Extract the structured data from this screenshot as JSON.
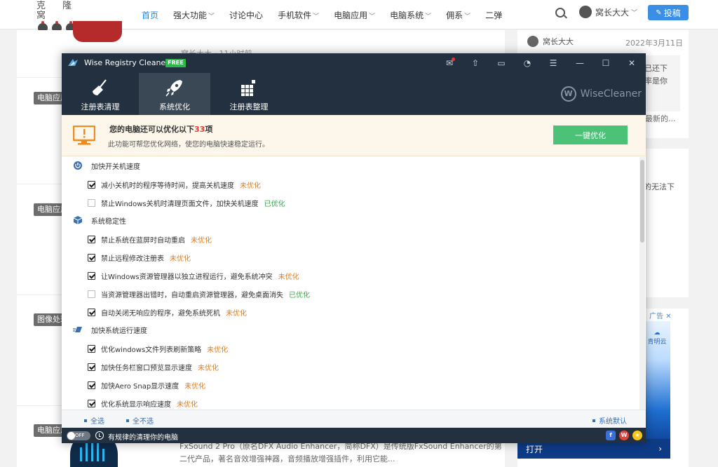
{
  "site": {
    "logo_text": "克 隆 窝",
    "nav": [
      {
        "label": "首页",
        "active": true,
        "has_menu": false
      },
      {
        "label": "强大功能",
        "has_menu": true
      },
      {
        "label": "讨论中心",
        "has_menu": false
      },
      {
        "label": "手机软件",
        "has_menu": true
      },
      {
        "label": "电脑应用",
        "has_menu": true
      },
      {
        "label": "电脑系统",
        "has_menu": true
      },
      {
        "label": "佣系",
        "has_menu": true
      },
      {
        "label": "二弹",
        "has_menu": false
      }
    ],
    "user_name": "窝长大大",
    "post_button": "投稿",
    "categories": [
      "电脑应用",
      "电脑应用",
      "图像处理",
      "电脑应用"
    ],
    "meta_text": "窝长大大 · 11小时前",
    "article_text": "FxSound 2 Pro（原名DFX Audio Enhancer，简称DFX）是传统版FxSound Enhancer的第二代产品，著名音效增强神器，音频播放增强插件，利用它能...",
    "sidebar": {
      "comment_user": "窝长大大",
      "comment_date": "2022年3月11日",
      "quote_lines": [
        "已还下",
        "率是你"
      ],
      "more_text": "最新的...",
      "side_text": "的无法下",
      "ad_label": "广告",
      "ad_brand": "青明云",
      "ad_cta": "打开"
    }
  },
  "app": {
    "title": "Wise Registry Cleaner X",
    "badge": "FREE",
    "brand": "WiseCleaner",
    "tabs": [
      {
        "label": "注册表清理",
        "icon": "broom-icon",
        "active": false
      },
      {
        "label": "系统优化",
        "icon": "rocket-icon",
        "active": true
      },
      {
        "label": "注册表整理",
        "icon": "blocks-icon",
        "active": false
      }
    ],
    "banner": {
      "title_prefix": "您的电脑还可以优化以下",
      "count": "33",
      "title_suffix": "项",
      "subtitle": "此功能可帮您优化网络，使您的电脑快速稳定运行。",
      "button": "一键优化"
    },
    "sections": [
      {
        "title": "加快开关机速度",
        "icon": "power-icon",
        "items": [
          {
            "label": "减小关机时的程序等待时间，提高关机速度",
            "checked": true,
            "status": "未优化"
          },
          {
            "label": "禁止Windows关机时清理页面文件，加快关机速度",
            "checked": false,
            "status": "已优化"
          }
        ]
      },
      {
        "title": "系统稳定性",
        "icon": "cube-icon",
        "items": [
          {
            "label": "禁止系统在蓝屏时自动重启",
            "checked": true,
            "status": "未优化"
          },
          {
            "label": "禁止远程修改注册表",
            "checked": true,
            "status": "未优化"
          },
          {
            "label": "让Windows资源管理器以独立进程运行，避免系统冲突",
            "checked": true,
            "status": "未优化"
          },
          {
            "label": "当资源管理器出错时，自动重启资源管理器，避免桌面消失",
            "checked": false,
            "status": "已优化"
          },
          {
            "label": "自动关闭无响应的程序，避免系统死机",
            "checked": true,
            "status": "未优化"
          }
        ]
      },
      {
        "title": "加快系统运行速度",
        "icon": "speed-icon",
        "items": [
          {
            "label": "优化windows文件列表刷新策略",
            "checked": true,
            "status": "未优化"
          },
          {
            "label": "加快任务栏窗口预览显示速度",
            "checked": true,
            "status": "未优化"
          },
          {
            "label": "加快Aero Snap显示速度",
            "checked": true,
            "status": "未优化"
          },
          {
            "label": "优化系统显示响应速度",
            "checked": true,
            "status": "未优化"
          }
        ]
      }
    ],
    "footer": {
      "select_all": "全选",
      "select_none": "全不选",
      "defaults": "系统默认"
    },
    "status": {
      "toggle": "OFF",
      "text": "有规律的清理你的电脑"
    },
    "colors": {
      "dark": "#23303f",
      "accent_green": "#4cc178",
      "todo": "#e07c1a",
      "done": "#3aa84c",
      "banner_bg": "#fdf6ea"
    }
  }
}
